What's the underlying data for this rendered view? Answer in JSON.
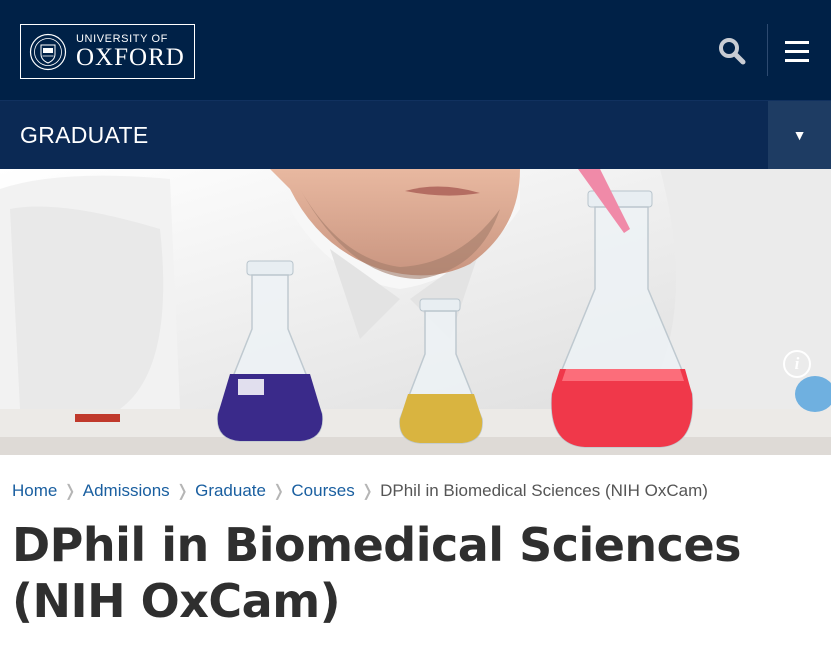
{
  "header": {
    "logo_small": "UNIVERSITY OF",
    "logo_big": "OXFORD",
    "search_icon": "search-icon",
    "menu_icon": "hamburger-menu-icon"
  },
  "section": {
    "title": "GRADUATE",
    "toggle_glyph": "▼"
  },
  "hero": {
    "info_glyph": "i"
  },
  "breadcrumb": {
    "items": [
      "Home",
      "Admissions",
      "Graduate",
      "Courses"
    ],
    "separator": "❭",
    "current": "DPhil in Biomedical Sciences (NIH OxCam)"
  },
  "page": {
    "title_line1": "DPhil in Biomedical Sciences",
    "title_line2": "(NIH OxCam)"
  },
  "colors": {
    "oxford_blue": "#002147",
    "section_bar": "#0b2954",
    "link": "#1a5fa0"
  }
}
